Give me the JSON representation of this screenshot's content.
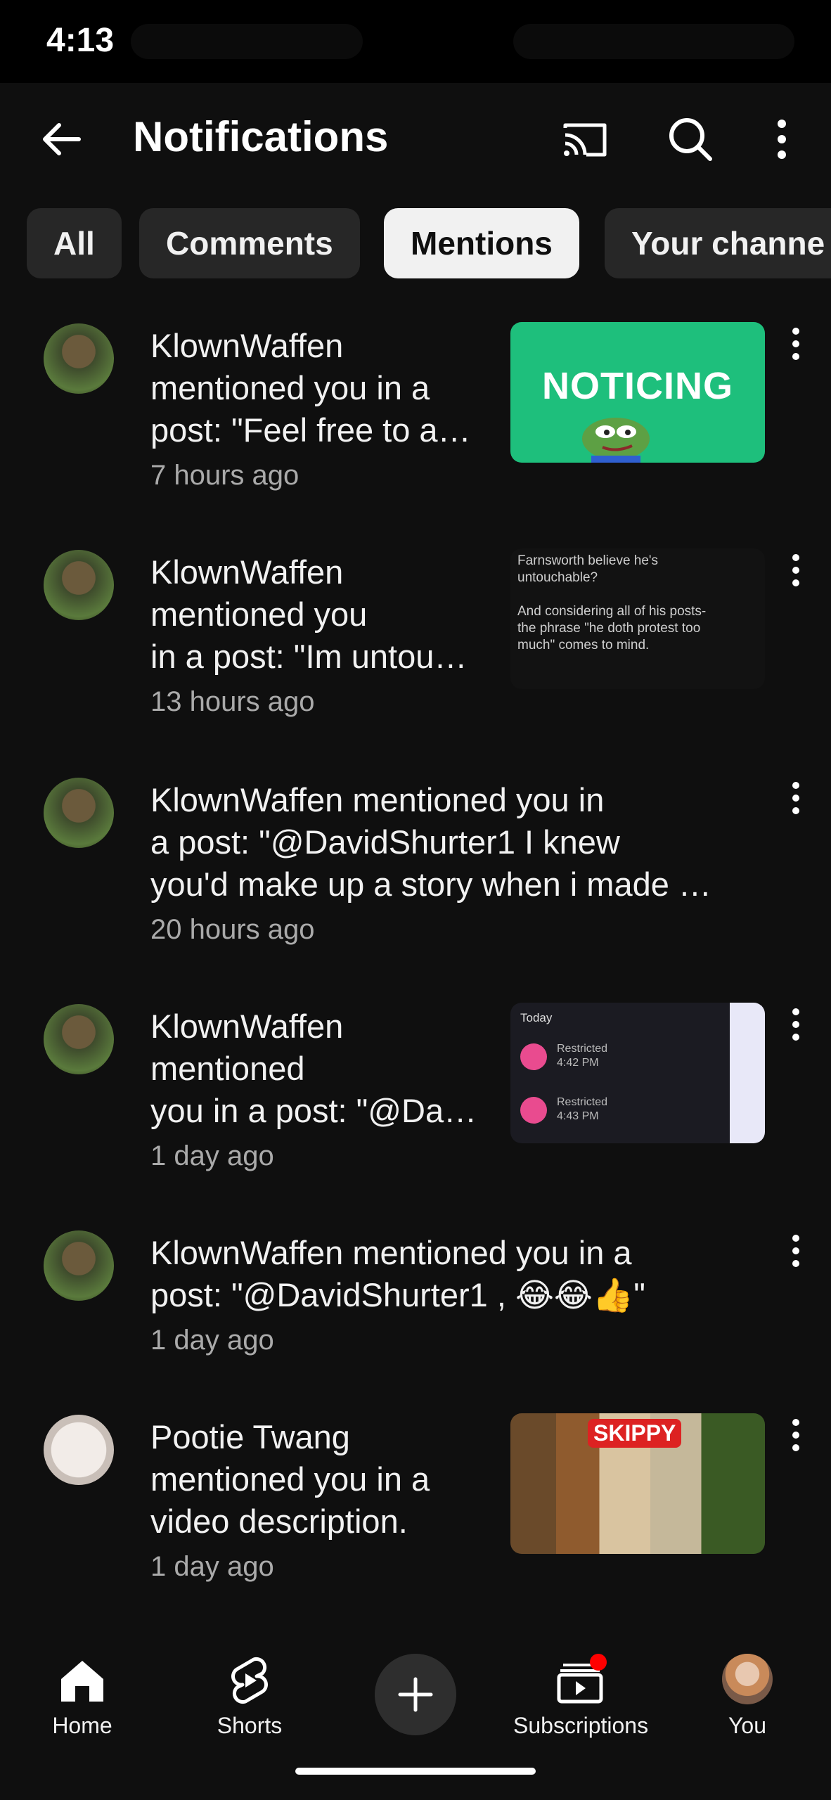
{
  "status_bar": {
    "time": "4:13"
  },
  "header": {
    "title": "Notifications",
    "icons": [
      "back-arrow-icon",
      "cast-icon",
      "search-icon",
      "more-vert-icon"
    ]
  },
  "filter_chips": [
    {
      "label": "All",
      "selected": false
    },
    {
      "label": "Comments",
      "selected": false
    },
    {
      "label": "Mentions",
      "selected": true
    },
    {
      "label": "Your channe",
      "selected": false
    }
  ],
  "notifications": [
    {
      "lines": [
        "KlownWaffen",
        "mentioned you in a",
        "post: \"Feel free to a…"
      ],
      "time": "7 hours ago",
      "thumb": {
        "kind": "image",
        "text": "NOTICING"
      }
    },
    {
      "lines": [
        "KlownWaffen",
        "mentioned you",
        "in a post: \"Im untou…"
      ],
      "time": "13 hours ago",
      "thumb": {
        "kind": "text-screenshot",
        "lines": [
          "Farnsworth believe he's",
          "untouchable?",
          "",
          "And considering all of his posts-",
          "the phrase \"he doth protest too",
          "much\" comes to mind."
        ]
      }
    },
    {
      "lines": [
        "KlownWaffen mentioned you in",
        "a post: \"@DavidShurter1  I knew",
        "you'd make up a story when i made …"
      ],
      "time": "20 hours ago",
      "thumb": null
    },
    {
      "lines": [
        "KlownWaffen",
        "mentioned",
        "you in a post: \"@Da…"
      ],
      "time": "1 day ago",
      "thumb": {
        "kind": "list-screenshot",
        "heading": "Today",
        "rows": [
          {
            "title": "Restricted",
            "time": "4:42 PM"
          },
          {
            "title": "Restricted",
            "time": "4:43 PM"
          }
        ]
      }
    },
    {
      "lines": [
        "KlownWaffen mentioned you in a",
        "post: \"@DavidShurter1 , 😂😂👍\""
      ],
      "time": "1 day ago",
      "thumb": null
    },
    {
      "lines": [
        "Pootie Twang",
        "mentioned you in a",
        "video description."
      ],
      "time": "1 day ago",
      "thumb": {
        "kind": "photo",
        "text": "SKIPPY"
      }
    }
  ],
  "bottom_nav": [
    {
      "label": "Home",
      "icon": "home-icon",
      "active": true
    },
    {
      "label": "Shorts",
      "icon": "shorts-icon",
      "active": false
    },
    {
      "label": "",
      "icon": "create-plus-icon",
      "active": false
    },
    {
      "label": "Subscriptions",
      "icon": "subscriptions-icon",
      "active": false,
      "badge": true
    },
    {
      "label": "You",
      "icon": "avatar",
      "active": false
    }
  ],
  "colors": {
    "background": "#0f0f0f",
    "chip": "#272727",
    "chip_active": "#f1f1f1",
    "secondary_text": "#aaaaaa",
    "badge": "#ff0000"
  }
}
